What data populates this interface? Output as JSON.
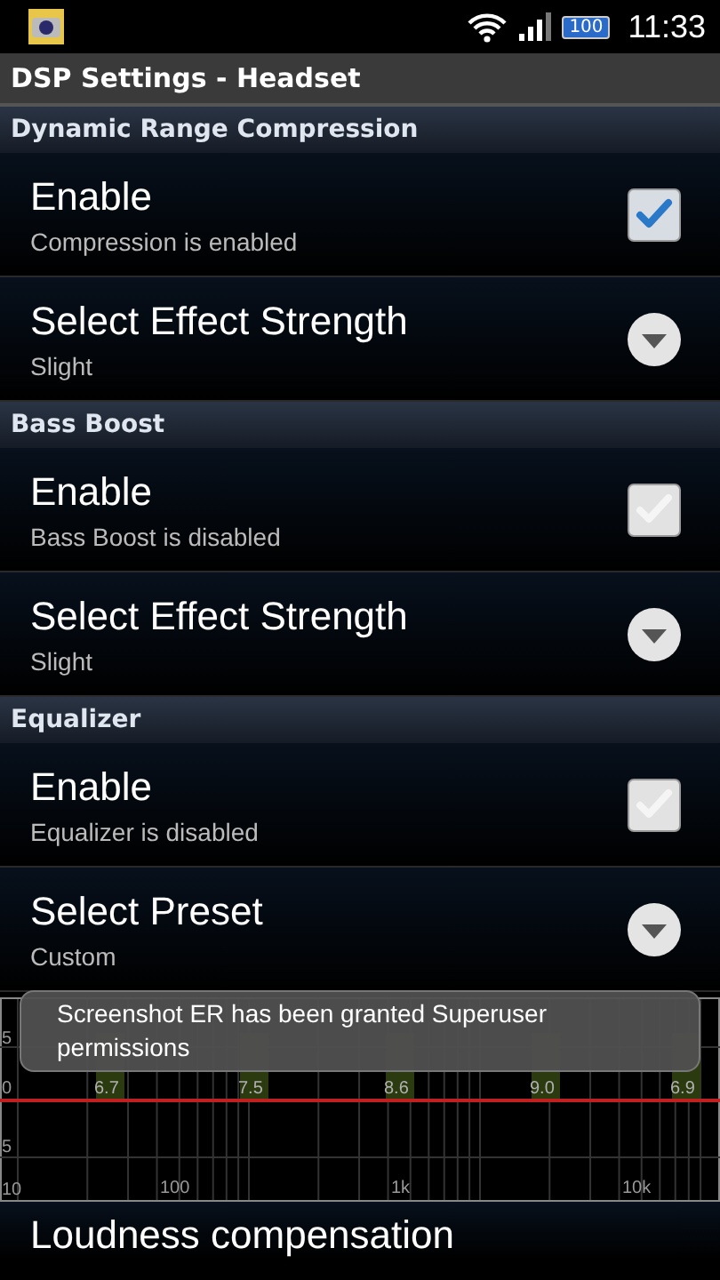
{
  "status_bar": {
    "battery": "100",
    "time": "11:33"
  },
  "title_bar": {
    "title": "DSP Settings - Headset"
  },
  "sections": [
    {
      "header": "Dynamic Range Compression",
      "rows": [
        {
          "kind": "checkbox",
          "title": "Enable",
          "summary": "Compression is enabled",
          "checked": true
        },
        {
          "kind": "dropdown",
          "title": "Select Effect Strength",
          "summary": "Slight"
        }
      ]
    },
    {
      "header": "Bass Boost",
      "rows": [
        {
          "kind": "checkbox",
          "title": "Enable",
          "summary": "Bass Boost is disabled",
          "checked": false
        },
        {
          "kind": "dropdown",
          "title": "Select Effect Strength",
          "summary": "Slight"
        }
      ]
    },
    {
      "header": "Equalizer",
      "rows": [
        {
          "kind": "checkbox",
          "title": "Enable",
          "summary": "Equalizer is disabled",
          "checked": false
        },
        {
          "kind": "dropdown",
          "title": "Select Preset",
          "summary": "Custom"
        }
      ]
    }
  ],
  "eq_graph": {
    "y_labels": [
      "5",
      "0",
      "5",
      "10"
    ],
    "x_labels": [
      "100",
      "1k",
      "10k"
    ],
    "band_values": [
      "6.7",
      "7.5",
      "8.6",
      "9.0",
      "6.9"
    ]
  },
  "next_row": {
    "title": "Loudness compensation"
  },
  "toast": {
    "text": "Screenshot ER has been granted Superuser permissions"
  }
}
